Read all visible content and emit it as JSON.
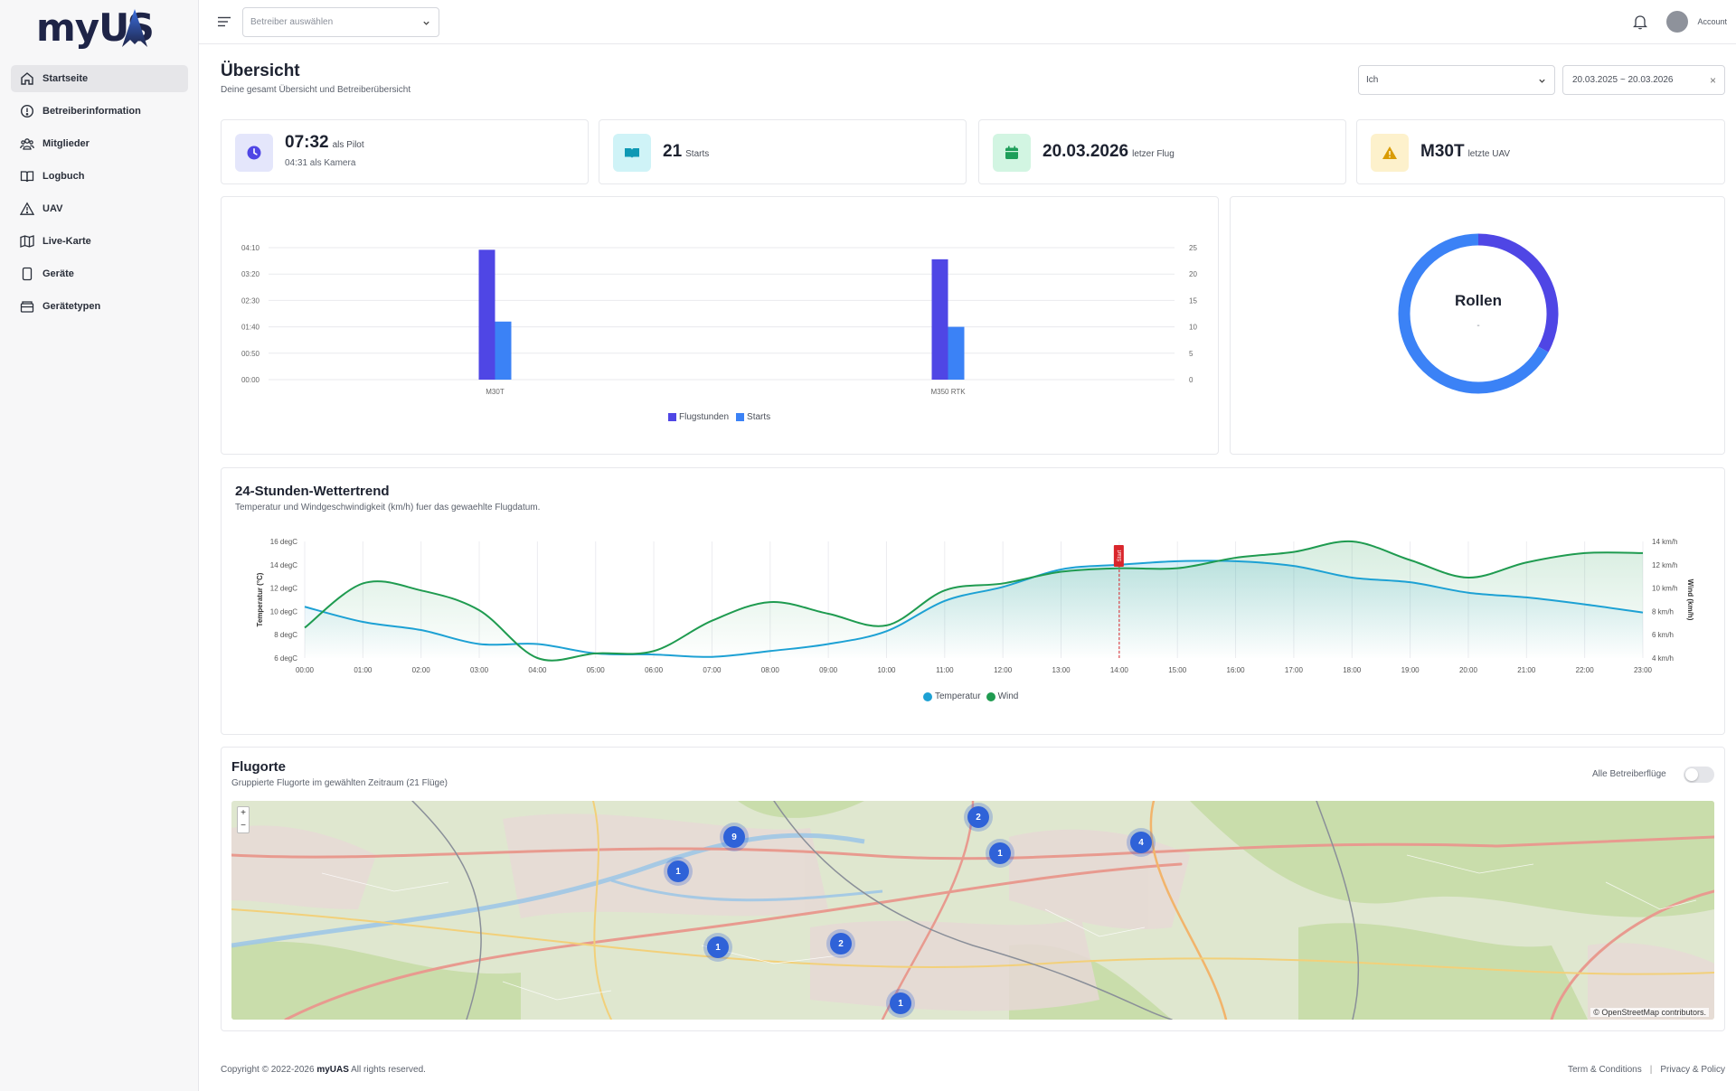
{
  "app": {
    "logo_text": "myUAS"
  },
  "sidebar": {
    "items": [
      {
        "label": "Startseite",
        "icon": "home-icon",
        "active": true
      },
      {
        "label": "Betreiberinformation",
        "icon": "info-circle-icon"
      },
      {
        "label": "Mitglieder",
        "icon": "users-icon"
      },
      {
        "label": "Logbuch",
        "icon": "book-icon"
      },
      {
        "label": "UAV",
        "icon": "triangle-warning-icon"
      },
      {
        "label": "Live-Karte",
        "icon": "map-icon"
      },
      {
        "label": "Geräte",
        "icon": "device-icon"
      },
      {
        "label": "Gerätetypen",
        "icon": "box-icon"
      }
    ]
  },
  "topbar": {
    "operator_placeholder": "Betreiber auswählen",
    "account_label": "Account"
  },
  "header": {
    "title": "Übersicht",
    "subtitle": "Deine gesamt Übersicht und Betreiberübersicht",
    "who_select": "Ich",
    "date_range": "20.03.2025 ~ 20.03.2026"
  },
  "stats": [
    {
      "value": "07:32",
      "label": "als Pilot",
      "sub": "04:31 als Kamera",
      "icon": "clock-icon",
      "bg": "#e4e6fb",
      "fg": "#4f46e5"
    },
    {
      "value": "21",
      "label": "Starts",
      "icon": "book-open-icon",
      "bg": "#cff3f7",
      "fg": "#0e98b4"
    },
    {
      "value": "20.03.2026",
      "label": "letzer Flug",
      "icon": "calendar-icon",
      "bg": "#d2f5e2",
      "fg": "#1e9e5a"
    },
    {
      "value": "M30T",
      "label": "letzte UAV",
      "icon": "triangle-icon",
      "bg": "#fdf1cc",
      "fg": "#d99b05"
    }
  ],
  "donut": {
    "title": "Rollen",
    "subtitle": "-"
  },
  "weather": {
    "title": "24-Stunden-Wettertrend",
    "subtitle": "Temperatur und Windgeschwindigkeit (km/h) fuer das gewaehlte Flugdatum."
  },
  "map": {
    "title": "Flugorte",
    "subtitle": "Gruppierte Flugorte im gewählten Zeitraum (21 Flüge)",
    "toggle_label": "Alle Betreiberflüge",
    "attribution": "© OpenStreetMap contributors.",
    "clusters": [
      "2",
      "9",
      "1",
      "4",
      "1",
      "1",
      "2",
      "1"
    ]
  },
  "footer": {
    "copyright_prefix": "Copyright © 2022-2026",
    "brand": "myUAS",
    "copyright_suffix": "All rights reserved.",
    "terms": "Term & Conditions",
    "privacy": "Privacy & Policy"
  },
  "colors": {
    "primary": "#4f46e5",
    "secondary": "#3b82f6",
    "temp": "#1da1d4",
    "wind": "#1f9b50",
    "marker": "#d9262c"
  },
  "chart_data": [
    {
      "type": "bar",
      "categories": [
        "M30T",
        "M350 RTK"
      ],
      "series": [
        {
          "name": "Flugstunden",
          "values": [
            4.1,
            3.8
          ]
        },
        {
          "name": "Starts",
          "values": [
            11,
            10
          ]
        }
      ],
      "y_left_ticks": [
        "00:00",
        "00:50",
        "01:40",
        "02:30",
        "03:20",
        "04:10"
      ],
      "y_left_range_hours": [
        0,
        4.1667
      ],
      "y_right_ticks": [
        "0",
        "5",
        "10",
        "15",
        "20",
        "25"
      ],
      "y_right_range": [
        0,
        25
      ],
      "legend": "bottom"
    },
    {
      "type": "pie",
      "title": "Rollen",
      "series": [
        {
          "values": [
            33,
            67
          ]
        }
      ]
    },
    {
      "type": "area",
      "x": [
        "00:00",
        "01:00",
        "02:00",
        "03:00",
        "04:00",
        "05:00",
        "06:00",
        "07:00",
        "08:00",
        "09:00",
        "10:00",
        "11:00",
        "12:00",
        "13:00",
        "14:00",
        "15:00",
        "16:00",
        "17:00",
        "18:00",
        "19:00",
        "20:00",
        "21:00",
        "22:00",
        "23:00"
      ],
      "series": [
        {
          "name": "Temperatur",
          "axis": "left",
          "unit": "degC",
          "values": [
            10.4,
            9.1,
            8.4,
            7.2,
            7.2,
            6.4,
            6.3,
            6.1,
            6.6,
            7.2,
            8.3,
            10.9,
            12.1,
            13.6,
            14.0,
            14.3,
            14.3,
            13.9,
            12.9,
            12.5,
            11.6,
            11.2,
            10.6,
            9.9
          ]
        },
        {
          "name": "Wind",
          "axis": "right",
          "unit": "km/h",
          "values": [
            6.6,
            10.4,
            9.8,
            8.1,
            4.0,
            4.4,
            4.6,
            7.2,
            8.8,
            7.8,
            6.8,
            9.8,
            10.4,
            11.4,
            11.7,
            11.7,
            12.6,
            13.1,
            14.0,
            12.4,
            10.9,
            12.2,
            13.0,
            13.0
          ]
        }
      ],
      "y_left_ticks": [
        "6 degC",
        "8 degC",
        "10 degC",
        "12 degC",
        "14 degC",
        "16 degC"
      ],
      "y_left_range": [
        6,
        16
      ],
      "y_right_ticks": [
        "4 km/h",
        "6 km/h",
        "8 km/h",
        "10 km/h",
        "12 km/h",
        "14 km/h"
      ],
      "y_right_range": [
        4,
        14
      ],
      "ylabel": "Temperatur (°C)",
      "ylabel_right": "Wind (km/h)",
      "marker_at": "14:00",
      "marker_label": "Start",
      "legend": "bottom"
    }
  ]
}
